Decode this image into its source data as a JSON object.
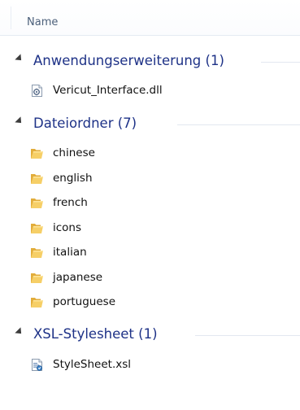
{
  "header": {
    "column_name": "Name"
  },
  "groups": [
    {
      "title": "Anwendungserweiterung (1)",
      "items": [
        {
          "name": "Vericut_Interface.dll",
          "icon": "dll-icon"
        }
      ]
    },
    {
      "title": "Dateiordner (7)",
      "items": [
        {
          "name": "chinese",
          "icon": "folder-icon"
        },
        {
          "name": "english",
          "icon": "folder-icon"
        },
        {
          "name": "french",
          "icon": "folder-icon"
        },
        {
          "name": "icons",
          "icon": "folder-icon"
        },
        {
          "name": "italian",
          "icon": "folder-icon"
        },
        {
          "name": "japanese",
          "icon": "folder-icon"
        },
        {
          "name": "portuguese",
          "icon": "folder-icon"
        }
      ]
    },
    {
      "title": "XSL-Stylesheet (1)",
      "items": [
        {
          "name": "StyleSheet.xsl",
          "icon": "xsl-icon"
        }
      ]
    }
  ],
  "colors": {
    "group_title": "#1e3287",
    "header_text": "#4c607a",
    "item_text": "#111111",
    "folder": "#f3c85a"
  }
}
